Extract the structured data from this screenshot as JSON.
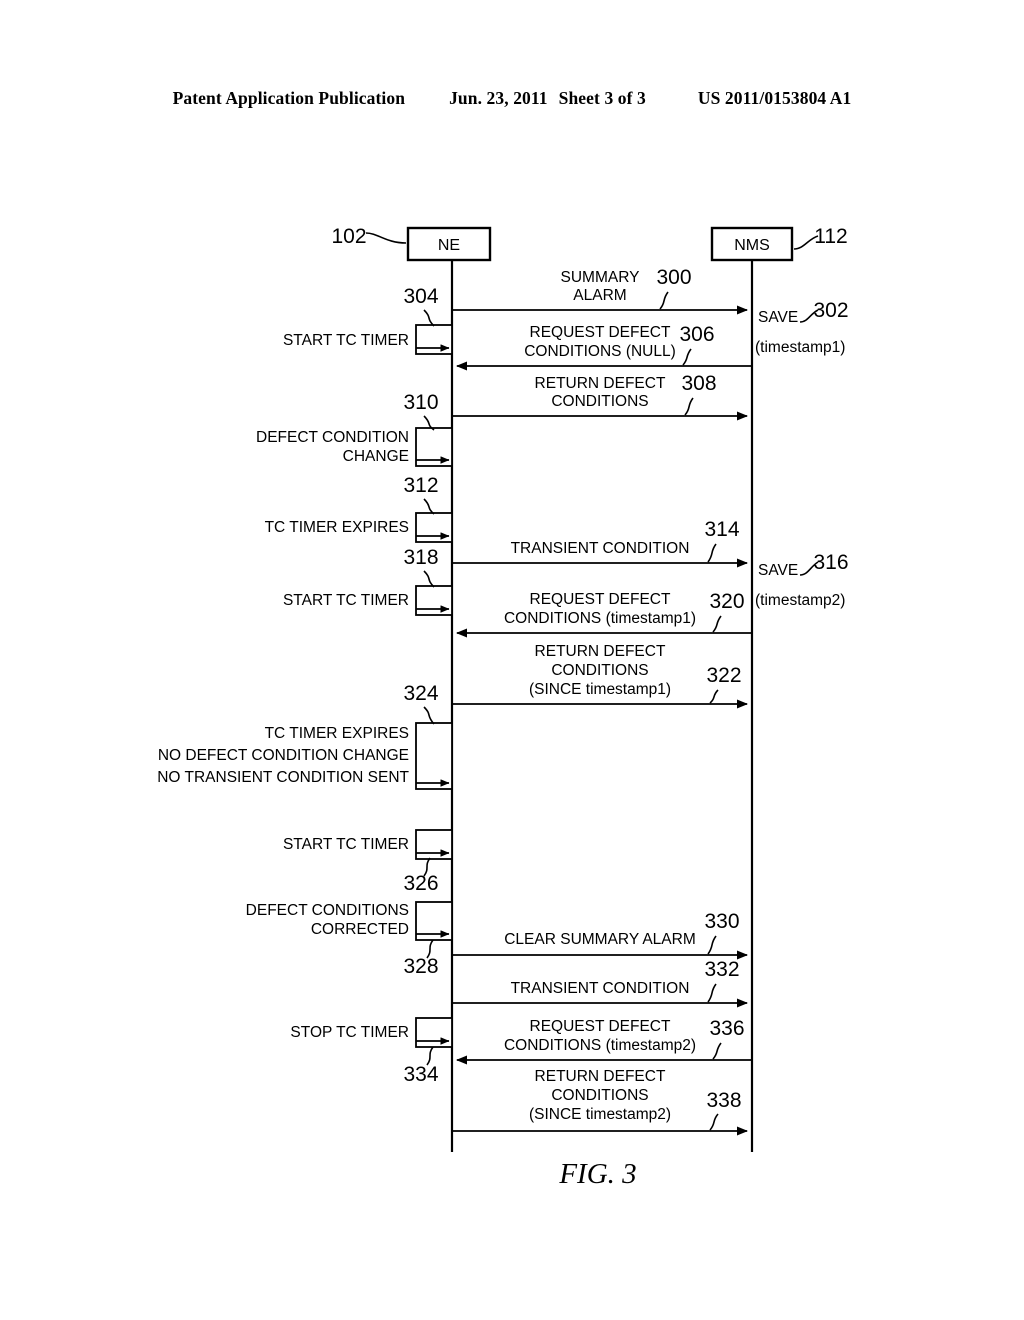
{
  "header": {
    "title": "Patent Application Publication",
    "date": "Jun. 23, 2011",
    "sheet": "Sheet 3 of 3",
    "number": "US 2011/0153804 A1"
  },
  "figure": {
    "caption": "FIG. 3"
  },
  "entities": [
    {
      "label": "NE",
      "ref": "102"
    },
    {
      "label": "NMS",
      "ref": "112"
    }
  ],
  "messages": [
    {
      "ref": "300",
      "lines": [
        "SUMMARY",
        "ALARM"
      ],
      "direction": "right"
    },
    {
      "ref": "306",
      "lines": [
        "REQUEST DEFECT",
        "CONDITIONS (NULL)"
      ],
      "direction": "left"
    },
    {
      "ref": "308",
      "lines": [
        "RETURN DEFECT",
        "CONDITIONS"
      ],
      "direction": "right"
    },
    {
      "ref": "314",
      "lines": [
        "TRANSIENT CONDITION"
      ],
      "direction": "right"
    },
    {
      "ref": "320",
      "lines": [
        "REQUEST DEFECT",
        "CONDITIONS (timestamp1)"
      ],
      "direction": "left"
    },
    {
      "ref": "322",
      "lines": [
        "RETURN DEFECT",
        "CONDITIONS",
        "(SINCE timestamp1)"
      ],
      "direction": "right"
    },
    {
      "ref": "330",
      "lines": [
        "CLEAR SUMMARY ALARM"
      ],
      "direction": "right"
    },
    {
      "ref": "332",
      "lines": [
        "TRANSIENT CONDITION"
      ],
      "direction": "right"
    },
    {
      "ref": "336",
      "lines": [
        "REQUEST DEFECT",
        "CONDITIONS (timestamp2)"
      ],
      "direction": "left"
    },
    {
      "ref": "338",
      "lines": [
        "RETURN DEFECT",
        "CONDITIONS",
        "(SINCE timestamp2)"
      ],
      "direction": "right"
    }
  ],
  "events": [
    {
      "ref": "304",
      "lines": [
        "START TC TIMER"
      ]
    },
    {
      "ref": "310",
      "lines": [
        "DEFECT CONDITION",
        "CHANGE"
      ]
    },
    {
      "ref": "312",
      "lines": [
        "TC TIMER EXPIRES"
      ]
    },
    {
      "ref": "318",
      "lines": [
        "START TC TIMER"
      ]
    },
    {
      "ref": "324",
      "lines": [
        "TC TIMER EXPIRES",
        "NO DEFECT CONDITION CHANGE",
        "NO TRANSIENT CONDITION SENT"
      ]
    },
    {
      "ref": "326",
      "lines": [
        "START TC TIMER"
      ]
    },
    {
      "ref": "328",
      "lines": [
        "DEFECT CONDITIONS",
        "CORRECTED"
      ]
    },
    {
      "ref": "334",
      "lines": [
        "STOP TC TIMER"
      ]
    }
  ],
  "annotations": [
    {
      "ref": "302",
      "lines": [
        "SAVE",
        "(timestamp1)"
      ]
    },
    {
      "ref": "316",
      "lines": [
        "SAVE",
        "(timestamp2)"
      ]
    }
  ]
}
